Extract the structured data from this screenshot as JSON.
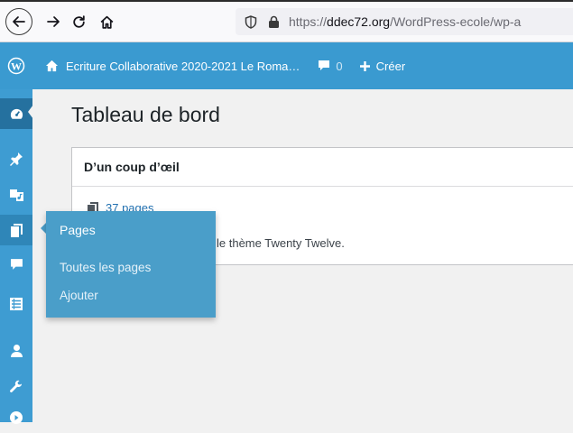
{
  "browser": {
    "url_host": "ddec72.org",
    "url_prefix": "https://",
    "url_path": "/WordPress-ecole/wp-a"
  },
  "adminbar": {
    "site_title": "Ecriture Collaborative 2020-2021 Le Roma…",
    "comments_count": "0",
    "new_label": "Créer"
  },
  "main": {
    "page_title": "Tableau de bord",
    "widget_title": "D’un coup d’œil",
    "pages_count": "37 pages",
    "theme_text": "le thème Twenty Twelve."
  },
  "flyout": {
    "heading": "Pages",
    "items": [
      "Toutes les pages",
      "Ajouter"
    ]
  },
  "colors": {
    "adminbar": "#3a9ad0",
    "sidebar": "#3e9cd2",
    "flyout": "#4a9ec9",
    "link": "#2271b1"
  },
  "icons": {
    "sidebar": [
      "dashboard-icon",
      "pin-icon",
      "media-icon",
      "pages-icon",
      "comments-icon",
      "list-icon",
      "users-icon",
      "wrench-icon",
      "play-icon"
    ]
  }
}
